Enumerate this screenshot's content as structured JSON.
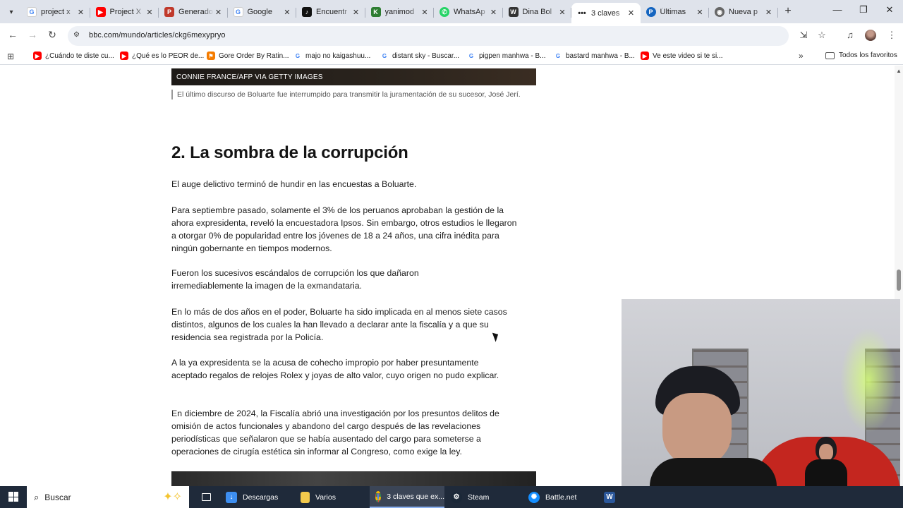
{
  "browser": {
    "tabs": [
      {
        "title": "project x",
        "favicon": "G",
        "color": "#4285f4"
      },
      {
        "title": "Project X",
        "favicon": "▶",
        "color": "#ff0000"
      },
      {
        "title": "Generado",
        "favicon": "P",
        "color": "#c0392b"
      },
      {
        "title": "Google",
        "favicon": "G",
        "color": "#4285f4"
      },
      {
        "title": "Encuentr",
        "favicon": "♪",
        "color": "#111111"
      },
      {
        "title": "yanimod",
        "favicon": "K",
        "color": "#2e7d32"
      },
      {
        "title": "WhatsAp",
        "favicon": "✆",
        "color": "#25d366"
      },
      {
        "title": "Dina Bol",
        "favicon": "W",
        "color": "#333333"
      },
      {
        "title": "3 claves",
        "favicon": "•••",
        "color": "#222222",
        "active": true
      },
      {
        "title": "Últimas",
        "favicon": "P",
        "color": "#1565c0"
      },
      {
        "title": "Nueva p",
        "favicon": "◉",
        "color": "#666666"
      }
    ],
    "url": "bbc.com/mundo/articles/ckg6mexypryo"
  },
  "bookmarks": [
    {
      "label": "¿Cuándo te diste cu...",
      "favicon": "▶",
      "color": "#ff0000"
    },
    {
      "label": "¿Qué es lo PEOR de...",
      "favicon": "▶",
      "color": "#ff0000"
    },
    {
      "label": "Gore Order By Ratin...",
      "favicon": "⚑",
      "color": "#f57c00"
    },
    {
      "label": "majo no kaigashuu...",
      "favicon": "G",
      "color": "#4285f4"
    },
    {
      "label": "distant sky - Buscar...",
      "favicon": "G",
      "color": "#4285f4"
    },
    {
      "label": "pigpen manhwa - B...",
      "favicon": "G",
      "color": "#4285f4"
    },
    {
      "label": "bastard manhwa - B...",
      "favicon": "G",
      "color": "#4285f4"
    },
    {
      "label": "Ve este video si te si...",
      "favicon": "▶",
      "color": "#ff0000"
    }
  ],
  "bookmarks_folder": "Todos los favoritos",
  "article": {
    "image_credit": "CONNIE FRANCE/AFP VIA GETTY IMAGES",
    "image_caption": "El último discurso de Boluarte fue interrumpido para transmitir la juramentación de su sucesor, José Jerí.",
    "heading": "2. La sombra de la corrupción",
    "paragraphs": [
      "El auge delictivo terminó de hundir en las encuestas a Boluarte.",
      "Para septiembre pasado, solamente el 3% de los peruanos aprobaban la gestión de la ahora expresidenta, reveló la encuestadora Ipsos. Sin embargo, otros estudios le llegaron a otorgar 0% de popularidad entre los jóvenes de 18 a 24 años, una cifra inédita para ningún gobernante en tiempos modernos.",
      "Fueron los sucesivos escándalos de corrupción los que dañaron irremediablemente la imagen de la exmandataria.",
      "En lo más de dos años en el poder, Boluarte ha sido implicada en al menos siete casos distintos, algunos de los cuales la han llevado a declarar ante la fiscalía y a que su residencia sea registrada por la Policía.",
      "A la ya expresidenta se la acusa de cohecho impropio por haber presuntamente aceptado regalos de relojes Rolex y joyas de alto valor, cuyo origen no pudo explicar.",
      "En diciembre de 2024, la Fiscalía abrió una investigación por los presuntos delitos de omisión de actos funcionales y abandono del cargo después de las revelaciones periodísticas que señalaron que se había ausentado del cargo para someterse a operaciones de cirugía estética sin informar al Congreso, como exige la ley."
    ]
  },
  "taskbar": {
    "search_label": "Buscar",
    "apps": [
      {
        "label": "Descargas",
        "icon": "download-icon",
        "color": "#3d8ef0"
      },
      {
        "label": "Varios",
        "icon": "folder-icon",
        "color": "#f2c94c"
      },
      {
        "label": "3 claves que ex...",
        "icon": "chrome-icon",
        "color": "#2e7d32",
        "active": true
      },
      {
        "label": "Steam",
        "icon": "steam-icon",
        "color": "#1b2838"
      },
      {
        "label": "Battle.net",
        "icon": "battlenet-icon",
        "color": "#148eff"
      },
      {
        "label": "",
        "icon": "word-icon",
        "color": "#2b579a"
      }
    ]
  }
}
